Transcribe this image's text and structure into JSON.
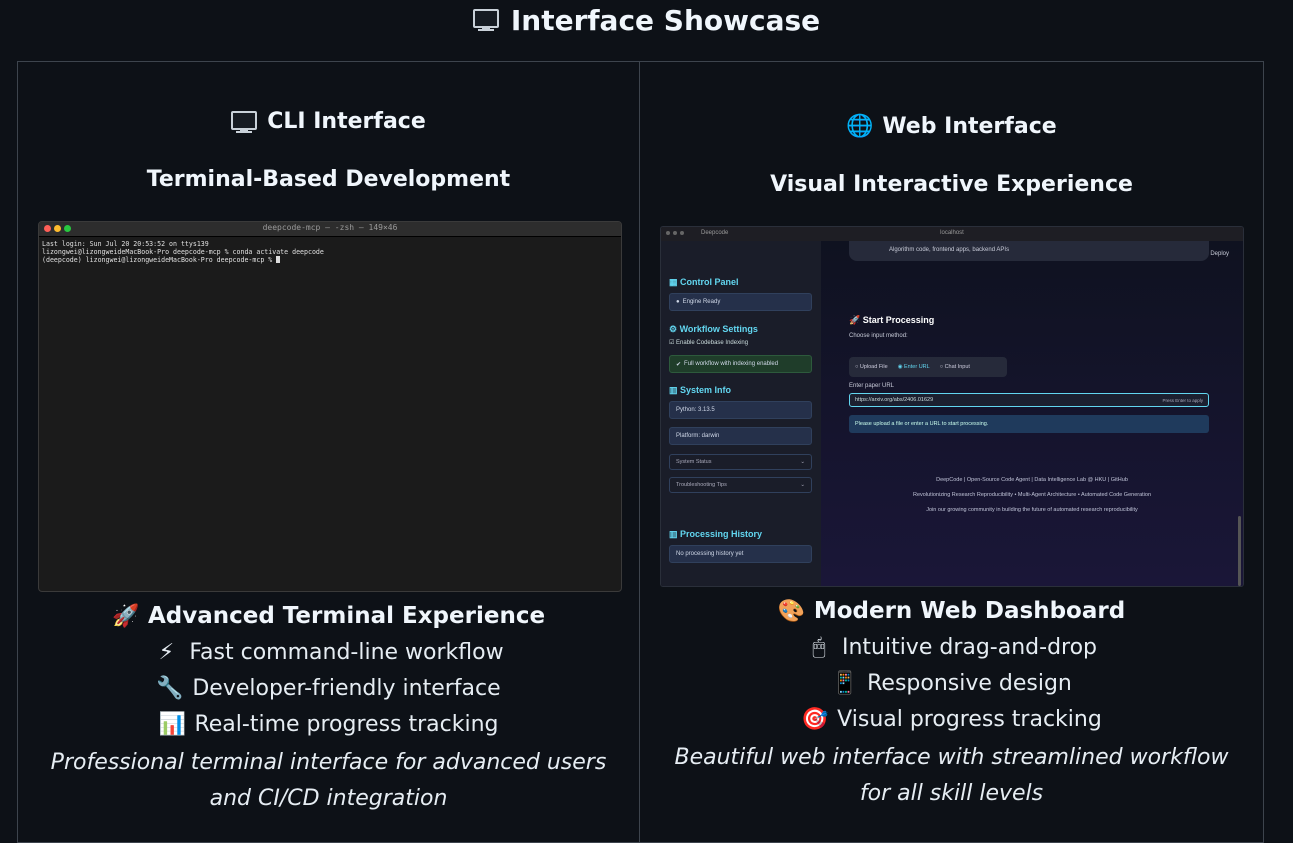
{
  "page": {
    "title": "Interface Showcase",
    "title_icon": "monitor-icon"
  },
  "cli": {
    "title": "CLI Interface",
    "subtitle": "Terminal-Based Development",
    "terminal": {
      "window_title": "deepcode-mcp — -zsh — 149×46",
      "lines": [
        "Last login: Sun Jul 20 20:53:52 on ttys139",
        "lizongwei@lizongweidеMacBook-Pro deepcode-mcp % conda activate deepcode",
        "(deepcode) lizongwei@lizongweideMacBook-Pro deepcode-mcp % "
      ]
    },
    "feature_heading": "Advanced Terminal Experience",
    "features": [
      {
        "icon": "⚡",
        "text": "Fast command-line workflow"
      },
      {
        "icon": "🔧",
        "text": "Developer-friendly interface"
      },
      {
        "icon": "📊",
        "text": "Real-time progress tracking"
      }
    ],
    "description": "Professional terminal interface for advanced users and CI/CD integration"
  },
  "web": {
    "title": "Web Interface",
    "subtitle": "Visual Interactive Experience",
    "screenshot": {
      "tab_label": "Deepcode",
      "address": "localhost",
      "deploy": "Deploy",
      "top_card_text": "Algorithm code, frontend apps, backend APIs",
      "sidebar": {
        "control_panel": "Control Panel",
        "engine_ready": "Engine Ready",
        "workflow_settings": "Workflow Settings",
        "enable_indexing": "Enable Codebase Indexing",
        "full_workflow": "Full workflow with indexing enabled",
        "system_info": "System Info",
        "python": "Python: 3.13.5",
        "platform": "Platform: darwin",
        "system_status": "System Status",
        "troubleshooting": "Troubleshooting Tips",
        "processing_history": "Processing History",
        "no_history": "No processing history yet"
      },
      "main": {
        "start_processing": "Start Processing",
        "choose_input": "Choose input method:",
        "upload_file": "Upload File",
        "enter_url": "Enter URL",
        "chat_input": "Chat Input",
        "paper_url_label": "Enter paper URL",
        "url_value": "https://arxiv.org/abs/2406.01629",
        "press_enter": "Press Enter to apply",
        "info_msg": "Please upload a file or enter a URL to start processing.",
        "footer1": "DeepCode | Open-Source Code Agent | Data Intelligence Lab @ HKU | GitHub",
        "footer2": "Revolutionizing Research Reproducibility • Multi-Agent Architecture • Automated Code Generation",
        "footer3": "Join our growing community in building the future of automated research reproducibility"
      }
    },
    "feature_heading": "Modern Web Dashboard",
    "features": [
      {
        "icon": "🖱",
        "text": "Intuitive drag-and-drop"
      },
      {
        "icon": "📱",
        "text": "Responsive design"
      },
      {
        "icon": "🎯",
        "text": "Visual progress tracking"
      }
    ],
    "description": "Beautiful web interface with streamlined workflow for all skill levels"
  },
  "colors": {
    "background": "#0d1117",
    "border": "#3d444d",
    "accent_cyan": "#62d6f0"
  }
}
